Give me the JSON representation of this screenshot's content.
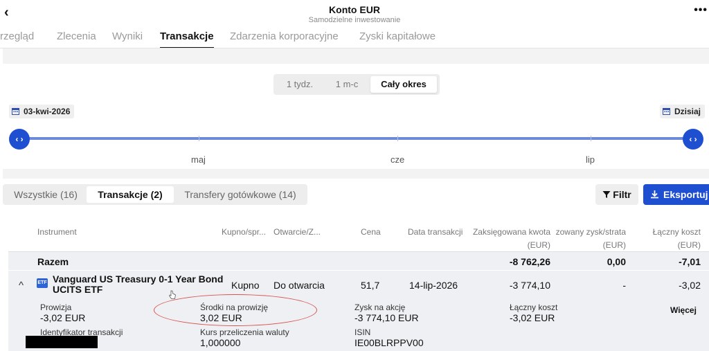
{
  "header": {
    "back_icon": "chevron-left-icon",
    "title": "Konto EUR",
    "subtitle": "Samodzielne inwestowanie",
    "more_icon": "more-horizontal-icon",
    "back_glyph": "‹",
    "more_glyph": "•••"
  },
  "tabs": [
    "Przegląd",
    "Zlecenia",
    "Wyniki",
    "Transakcje",
    "Zdarzenia korporacyjne",
    "Zyski kapitałowe"
  ],
  "tabs_visible": [
    "rzegląd",
    "Zlecenia",
    "Wyniki",
    "Transakcje",
    "Zdarzenia korporacyjne",
    "Zyski kapitałowe"
  ],
  "active_tab": "Transakcje",
  "period": {
    "options": [
      "1 tydz.",
      "1 m-c",
      "Cały okres"
    ],
    "selected": "Cały okres"
  },
  "range": {
    "start_date": "03-kwi-2026",
    "end_label": "Dzisiaj",
    "months": [
      "maj",
      "cze",
      "lip"
    ],
    "knob_glyph": "‹ ›"
  },
  "type_filter": {
    "options": [
      "Wszystkie (16)",
      "Transakcje (2)",
      "Transfery gotówkowe (14)"
    ],
    "selected": "Transakcje (2)"
  },
  "actions": {
    "filter_label": "Filtr",
    "export_label": "Eksportuj",
    "filter_icon": "funnel-icon",
    "export_icon": "download-icon"
  },
  "table": {
    "columns": {
      "instrument": "Instrument",
      "side": "Kupno/spr...",
      "open_close": "Otwarcie/Z...",
      "price": "Cena",
      "trade_date": "Data transakcji",
      "booked_amount": "Zaksięgowana kwota",
      "booked_unit": "(EUR)",
      "realized": "zowany zysk/strata",
      "realized_unit": "(EUR)",
      "total_cost": "Łączny koszt",
      "total_cost_unit": "(EUR)"
    },
    "total_row": {
      "label": "Razem",
      "booked_amount": "-8 762,26",
      "realized": "0,00",
      "total_cost": "-7,01"
    },
    "row": {
      "expand_glyph": "^",
      "instrument_icon_text": "ETF",
      "instrument_line1": "Vanguard US Treasury 0-1 Year Bond",
      "instrument_line2": "UCITS ETF",
      "side": "Kupno",
      "open_close": "Do otwarcia",
      "price": "51,7",
      "trade_date": "14-lip-2026",
      "booked_amount": "-3 774,10",
      "realized": "-",
      "total_cost": "-3,02"
    },
    "details": {
      "commission_label": "Prowizja",
      "commission_value": "-3,02 EUR",
      "fee_funds_label": "Środki na prowizję",
      "fee_funds_value": "3,02 EUR",
      "profit_per_share_label": "Zysk na akcję",
      "profit_per_share_value": "-3 774,10 EUR",
      "total_cost_label": "Łączny koszt",
      "total_cost_value": "-3,02 EUR",
      "more_label": "Więcej",
      "txn_id_label": "Identyfikator transakcji",
      "fx_rate_label": "Kurs przeliczenia waluty",
      "fx_rate_value": "1,000000",
      "isin_label": "ISIN",
      "isin_value": "IE00BLRPPV00"
    }
  },
  "colors": {
    "accent": "#1f4fd1",
    "track": "#6d8ad8",
    "annotation": "#d9534f",
    "row_bg": "#eef0f3"
  }
}
